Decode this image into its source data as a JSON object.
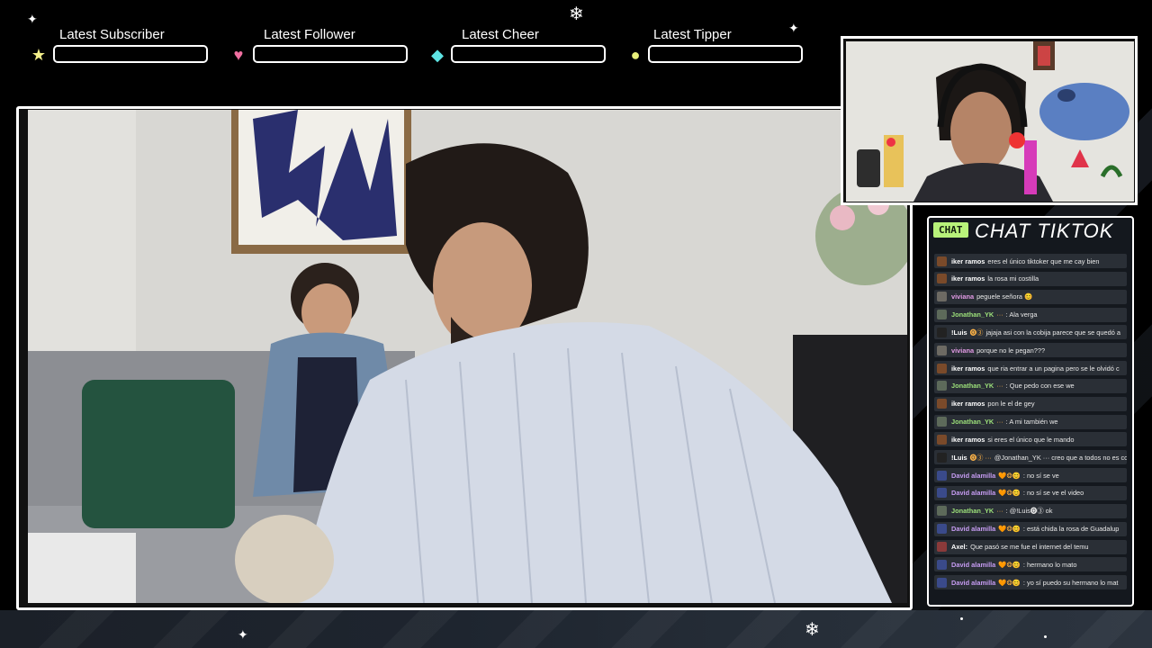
{
  "overlay": {
    "alerts": [
      {
        "label": "Latest Subscriber",
        "icon": "star-icon",
        "icon_glyph": "★",
        "icon_color": "#f4f08a"
      },
      {
        "label": "Latest Follower",
        "icon": "heart-icon",
        "icon_glyph": "♥",
        "icon_color": "#f06fa0"
      },
      {
        "label": "Latest Cheer",
        "icon": "diamond-icon",
        "icon_glyph": "◆",
        "icon_color": "#5ee4e4"
      },
      {
        "label": "Latest Tipper",
        "icon": "coin-icon",
        "icon_glyph": "●",
        "icon_color": "#e8f07a"
      }
    ]
  },
  "chat": {
    "tag": "CHAT",
    "title": "CHAT TIKTOK",
    "tag_color": "#b8f27a",
    "messages": [
      {
        "user": "iker ramos",
        "badges": "",
        "text": "eres el único tiktoker que me cay bien",
        "user_color": "#ffffff"
      },
      {
        "user": "iker ramos",
        "badges": "",
        "text": "la rosa mi costilla",
        "user_color": "#ffffff"
      },
      {
        "user": "viviana",
        "badges": "",
        "text": "peguele señora 😊",
        "user_color": "#e39be6"
      },
      {
        "user": "Jonathan_YK",
        "badges": "···",
        "text": ": Ala verga",
        "user_color": "#9ce07a"
      },
      {
        "user": "!Luis",
        "badges": "🅞③",
        "text": "jajaja asi con la cobija parece que se quedó a",
        "user_color": "#ffffff"
      },
      {
        "user": "viviana",
        "badges": "",
        "text": "porque no le pegan???",
        "user_color": "#e39be6"
      },
      {
        "user": "iker ramos",
        "badges": "",
        "text": "que ria entrar a un pagina pero se le olvidó c",
        "user_color": "#ffffff"
      },
      {
        "user": "Jonathan_YK",
        "badges": "···",
        "text": ": Que pedo con ese we",
        "user_color": "#9ce07a"
      },
      {
        "user": "iker ramos",
        "badges": "",
        "text": "pon le el de gey",
        "user_color": "#ffffff"
      },
      {
        "user": "Jonathan_YK",
        "badges": "···",
        "text": ": A mi también we",
        "user_color": "#9ce07a"
      },
      {
        "user": "iker ramos",
        "badges": "",
        "text": "si eres el único que le mando",
        "user_color": "#ffffff"
      },
      {
        "user": "!Luis",
        "badges": "🅞③ ···",
        "text": "@Jonathan_YK ···  creo que a todos no es cor",
        "user_color": "#ffffff"
      },
      {
        "user": "David alamilla",
        "badges": "🧡❂😊",
        "text": ": no sí se ve",
        "user_color": "#c69cf2"
      },
      {
        "user": "David alamilla",
        "badges": "🧡❂😊",
        "text": ": no sí se ve el video",
        "user_color": "#c69cf2"
      },
      {
        "user": "Jonathan_YK",
        "badges": "···",
        "text": ": @!Luis🅞③ ok",
        "user_color": "#9ce07a"
      },
      {
        "user": "David alamilla",
        "badges": "🧡❂😊",
        "text": ": está chida la rosa de Guadalup",
        "user_color": "#c69cf2"
      },
      {
        "user": "Axel:",
        "badges": "",
        "text": "Que pasó se me fue el internet del temu",
        "user_color": "#ffffff"
      },
      {
        "user": "David alamilla",
        "badges": "🧡❂😊",
        "text": ": hermano lo mato",
        "user_color": "#c69cf2"
      },
      {
        "user": "David alamilla",
        "badges": "🧡❂😊",
        "text": ": yo sí puedo su hermano lo mat",
        "user_color": "#c69cf2"
      }
    ]
  }
}
